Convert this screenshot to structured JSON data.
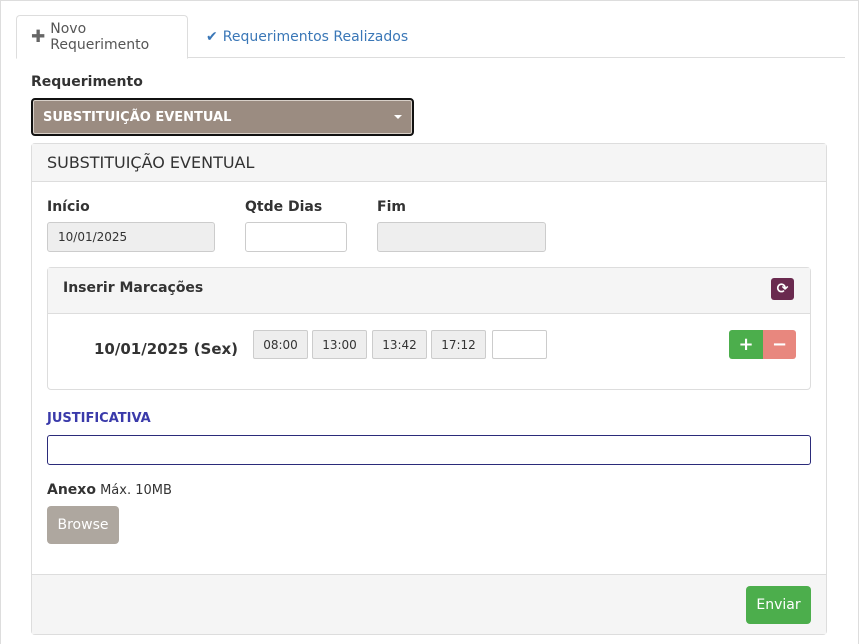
{
  "tabs": [
    {
      "icon": "plus-icon",
      "label": "Novo Requerimento",
      "active": true
    },
    {
      "icon": "check-icon",
      "label": "Requerimentos Realizados",
      "active": false
    }
  ],
  "requerimento": {
    "label": "Requerimento",
    "selected": "SUBSTITUIÇÃO EVENTUAL"
  },
  "panel": {
    "title": "SUBSTITUIÇÃO EVENTUAL",
    "inicio": {
      "label": "Início",
      "value": "10/01/2025"
    },
    "qtde_dias": {
      "label": "Qtde Dias",
      "value": ""
    },
    "fim": {
      "label": "Fim",
      "value": ""
    },
    "marcacoes": {
      "title": "Inserir Marcações",
      "date": "10/01/2025 (Sex)",
      "times": [
        "08:00",
        "13:00",
        "13:42",
        "17:12"
      ],
      "new_time": "",
      "plus": "+",
      "minus": "−"
    },
    "justificativa": {
      "label": "JUSTIFICATIVA",
      "value": ""
    },
    "anexo": {
      "label": "Anexo",
      "hint": "Máx. 10MB",
      "browse": "Browse"
    },
    "submit": "Enviar"
  },
  "colors": {
    "select_bg": "#9b8c81",
    "link_blue": "#3a77b7",
    "success": "#4cae4c",
    "danger_light": "#e8877e",
    "refresh_bg": "#6a2a4f",
    "justif_label": "#3a3aaa"
  }
}
